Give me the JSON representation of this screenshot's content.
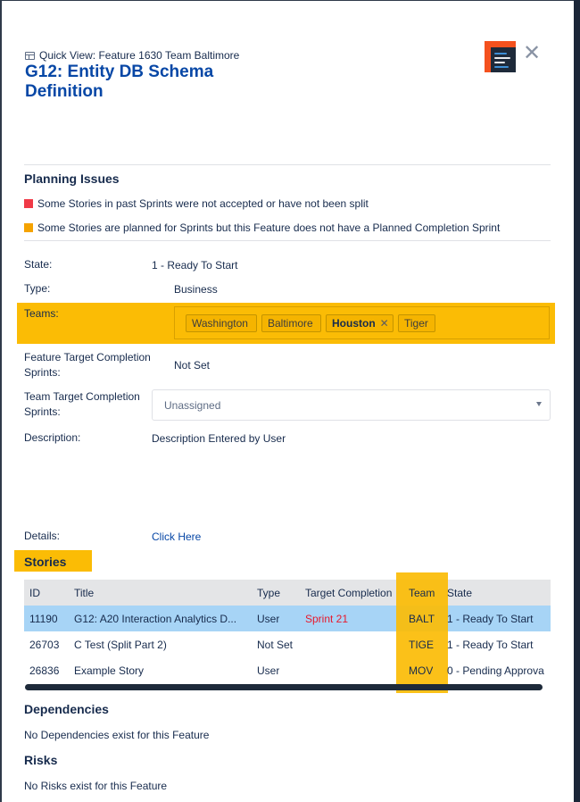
{
  "header": {
    "quick_view_label": "Quick View: Feature 1630 Team Baltimore",
    "title": "G12: Entity DB Schema Definition",
    "logo_icon": "app-logo-icon",
    "close_icon": "close-icon"
  },
  "planning": {
    "heading": "Planning Issues",
    "issues": [
      {
        "text": "Some Stories in past Sprints were not accepted or have not been split",
        "color": "#f03a47"
      },
      {
        "text": "Some Stories are planned for Sprints but this Feature does not have a Planned Completion Sprint",
        "color": "#f5a300"
      }
    ]
  },
  "fields": {
    "state_label": "State:",
    "state_value": "1 - Ready To Start",
    "type_label": "Type:",
    "type_value": "Business",
    "teams_label": "Teams:",
    "teams": [
      "Washington",
      "Baltimore",
      "Houston",
      "Tiger"
    ],
    "selected_team": "Houston",
    "ftc_label": "Feature Target Completion Sprints:",
    "ftc_value": "Not Set",
    "ttc_label": "Team Target Completion Sprints:",
    "ttc_placeholder": "Unassigned",
    "desc_label": "Description:",
    "desc_value": "Description Entered by User",
    "details_label": "Details:",
    "details_link": "Click Here"
  },
  "stories": {
    "heading": "Stories",
    "columns": [
      "ID",
      "Title",
      "Type",
      "Target Completion",
      "Team",
      "State"
    ],
    "rows": [
      {
        "id": "11190",
        "title": "G12: A20 Interaction Analytics D...",
        "type": "User",
        "target": "Sprint 21",
        "team": "BALT",
        "state": "1 - Ready To Start"
      },
      {
        "id": "26703",
        "title": "C Test (Split Part 2)",
        "type": "Not Set",
        "target": "",
        "team": "TIGE",
        "state": "1 - Ready To Start"
      },
      {
        "id": "26836",
        "title": "Example Story",
        "type": "User",
        "target": "",
        "team": "MOV",
        "state": "0 - Pending Approva"
      }
    ]
  },
  "dependencies": {
    "heading": "Dependencies",
    "text": "No Dependencies exist for this Feature"
  },
  "risks": {
    "heading": "Risks",
    "text": "No Risks exist for this Feature"
  },
  "colors": {
    "accent_link": "#0747a6",
    "highlight": "#fbbc05",
    "selected_row": "#a7d4f6"
  }
}
